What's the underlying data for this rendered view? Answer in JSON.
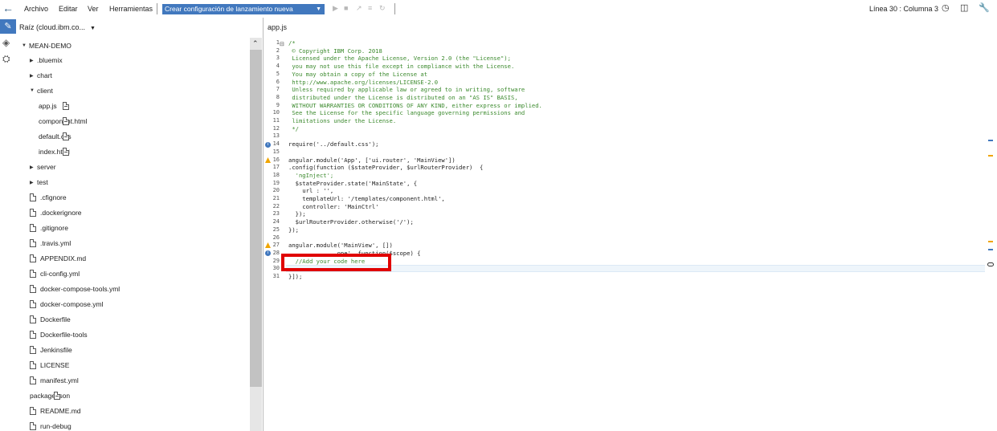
{
  "toolbar": {
    "menus": [
      "Archivo",
      "Editar",
      "Ver",
      "Herramientas"
    ],
    "launch_config": "Crear configuración de lanzamiento nueva",
    "status": "Línea 30 : Columna 3"
  },
  "sidebar": {
    "root": "Raíz (cloud.ibm.co...",
    "project": "MEAN-DEMO",
    "items": [
      {
        "label": ".bluemix",
        "type": "folder",
        "indent": 1,
        "expanded": false
      },
      {
        "label": "chart",
        "type": "folder",
        "indent": 1,
        "expanded": false
      },
      {
        "label": "client",
        "type": "folder",
        "indent": 1,
        "expanded": true
      },
      {
        "label": "app.js",
        "type": "code",
        "indent": 2
      },
      {
        "label": "component.html",
        "type": "code",
        "indent": 2
      },
      {
        "label": "default.css",
        "type": "code",
        "indent": 2
      },
      {
        "label": "index.html",
        "type": "code",
        "indent": 2
      },
      {
        "label": "server",
        "type": "folder",
        "indent": 1,
        "expanded": false
      },
      {
        "label": "test",
        "type": "folder",
        "indent": 1,
        "expanded": false
      },
      {
        "label": ".cfignore",
        "type": "file",
        "indent": 1
      },
      {
        "label": ".dockerignore",
        "type": "file",
        "indent": 1
      },
      {
        "label": ".gitignore",
        "type": "file",
        "indent": 1
      },
      {
        "label": ".travis.yml",
        "type": "file",
        "indent": 1
      },
      {
        "label": "APPENDIX.md",
        "type": "file",
        "indent": 1
      },
      {
        "label": "cli-config.yml",
        "type": "file",
        "indent": 1
      },
      {
        "label": "docker-compose-tools.yml",
        "type": "file",
        "indent": 1
      },
      {
        "label": "docker-compose.yml",
        "type": "file",
        "indent": 1
      },
      {
        "label": "Dockerfile",
        "type": "file",
        "indent": 1
      },
      {
        "label": "Dockerfile-tools",
        "type": "file",
        "indent": 1
      },
      {
        "label": "Jenkinsfile",
        "type": "file",
        "indent": 1
      },
      {
        "label": "LICENSE",
        "type": "file",
        "indent": 1
      },
      {
        "label": "manifest.yml",
        "type": "file",
        "indent": 1
      },
      {
        "label": "package.json",
        "type": "code",
        "indent": 1
      },
      {
        "label": "README.md",
        "type": "file",
        "indent": 1
      },
      {
        "label": "run-debug",
        "type": "file",
        "indent": 1
      }
    ]
  },
  "editor": {
    "tab": "app.js",
    "lines": [
      {
        "n": "1",
        "t": "/*",
        "c": "cm"
      },
      {
        "n": "2",
        "t": " © Copyright IBM Corp. 2018",
        "c": "cm"
      },
      {
        "n": "3",
        "t": " Licensed under the Apache License, Version 2.0 (the \"License\");",
        "c": "cm"
      },
      {
        "n": "4",
        "t": " you may not use this file except in compliance with the License.",
        "c": "cm"
      },
      {
        "n": "5",
        "t": " You may obtain a copy of the License at",
        "c": "cm"
      },
      {
        "n": "6",
        "t": " http://www.apache.org/licenses/LICENSE-2.0",
        "c": "cm"
      },
      {
        "n": "7",
        "t": " Unless required by applicable law or agreed to in writing, software",
        "c": "cm"
      },
      {
        "n": "8",
        "t": " distributed under the License is distributed on an \"AS IS\" BASIS,",
        "c": "cm"
      },
      {
        "n": "9",
        "t": " WITHOUT WARRANTIES OR CONDITIONS OF ANY KIND, either express or implied.",
        "c": "cm"
      },
      {
        "n": "10",
        "t": " See the License for the specific language governing permissions and",
        "c": "cm"
      },
      {
        "n": "11",
        "t": " limitations under the License.",
        "c": "cm"
      },
      {
        "n": "12",
        "t": " */",
        "c": "cm"
      },
      {
        "n": "13",
        "t": "",
        "c": ""
      },
      {
        "n": "14",
        "t": "require('../default.css');",
        "c": ""
      },
      {
        "n": "15",
        "t": "",
        "c": ""
      },
      {
        "n": "16",
        "t": "angular.module('App', ['ui.router', 'MainView'])",
        "c": ""
      },
      {
        "n": "17",
        "t": ".config(function ($stateProvider, $urlRouterProvider)  {",
        "c": ""
      },
      {
        "n": "18",
        "t": "  'ngInject';",
        "c": "str"
      },
      {
        "n": "19",
        "t": "  $stateProvider.state('MainState', {",
        "c": ""
      },
      {
        "n": "20",
        "t": "    url : '',",
        "c": ""
      },
      {
        "n": "21",
        "t": "    templateUrl: '/templates/component.html',",
        "c": ""
      },
      {
        "n": "22",
        "t": "    controller: 'MainCtrl'",
        "c": ""
      },
      {
        "n": "23",
        "t": "  });",
        "c": ""
      },
      {
        "n": "24",
        "t": "  $urlRouterProvider.otherwise('/');",
        "c": ""
      },
      {
        "n": "25",
        "t": "});",
        "c": ""
      },
      {
        "n": "26",
        "t": "",
        "c": ""
      },
      {
        "n": "27",
        "t": "angular.module('MainView', [])",
        "c": ""
      },
      {
        "n": "28",
        "t": "              ope', function($scope) {",
        "c": ""
      },
      {
        "n": "29",
        "t": "  //Add your code here",
        "c": "cm"
      },
      {
        "n": "30",
        "t": "",
        "c": ""
      },
      {
        "n": "31",
        "t": "}]);",
        "c": ""
      }
    ]
  },
  "colors": {
    "accent": "#4178be",
    "highlight_box": "#e00000",
    "comment": "#3c8a2e",
    "keyword": "#7a2f9b"
  }
}
